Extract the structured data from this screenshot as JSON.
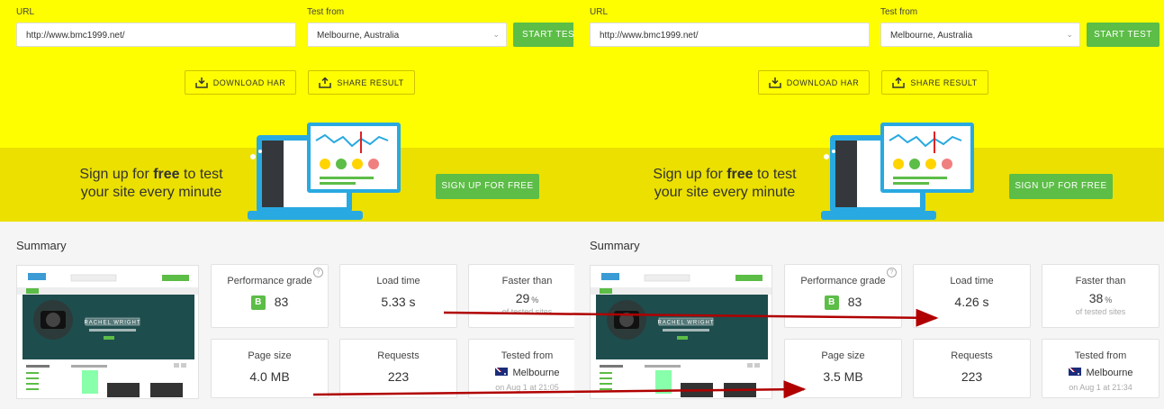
{
  "panels": [
    {
      "url_label": "URL",
      "url_value": "http://www.bmc1999.net/",
      "test_from_label": "Test from",
      "test_from_value": "Melbourne, Australia",
      "start_test": "START TEST",
      "download_har": "DOWNLOAD HAR",
      "share_result": "SHARE RESULT",
      "signup_pre": "Sign up for ",
      "signup_bold": "free",
      "signup_post": " to test",
      "signup_line2": "your site every minute",
      "signup_button": "SIGN UP FOR FREE",
      "summary": "Summary",
      "performance_grade_label": "Performance grade",
      "grade_letter": "B",
      "grade_value": "83",
      "load_time_label": "Load time",
      "load_time_value": "5.33 s",
      "faster_than_label": "Faster than",
      "faster_than_value": "29",
      "faster_than_unit": "%",
      "faster_than_sub": "of tested sites",
      "page_size_label": "Page size",
      "page_size_value": "4.0 MB",
      "requests_label": "Requests",
      "requests_value": "223",
      "tested_from_label": "Tested from",
      "tested_from_city": "Melbourne",
      "tested_from_date": "on Aug 1 at 21:05"
    },
    {
      "url_label": "URL",
      "url_value": "http://www.bmc1999.net/",
      "test_from_label": "Test from",
      "test_from_value": "Melbourne, Australia",
      "start_test": "START TEST",
      "download_har": "DOWNLOAD HAR",
      "share_result": "SHARE RESULT",
      "signup_pre": "Sign up for ",
      "signup_bold": "free",
      "signup_post": " to test",
      "signup_line2": "your site every minute",
      "signup_button": "SIGN UP FOR FREE",
      "summary": "Summary",
      "performance_grade_label": "Performance grade",
      "grade_letter": "B",
      "grade_value": "83",
      "load_time_label": "Load time",
      "load_time_value": "4.26 s",
      "faster_than_label": "Faster than",
      "faster_than_value": "38",
      "faster_than_unit": "%",
      "faster_than_sub": "of tested sites",
      "page_size_label": "Page size",
      "page_size_value": "3.5 MB",
      "requests_label": "Requests",
      "requests_value": "223",
      "tested_from_label": "Tested from",
      "tested_from_city": "Melbourne",
      "tested_from_date": "on Aug 1 at 21:34"
    }
  ],
  "thumbnail": {
    "hero_text": "RACHEL WRIGHT"
  },
  "colors": {
    "hero_yellow": "#fefe00",
    "band_yellow": "#ebe000",
    "green": "#5cbd47",
    "arrow_red": "#b00000"
  }
}
